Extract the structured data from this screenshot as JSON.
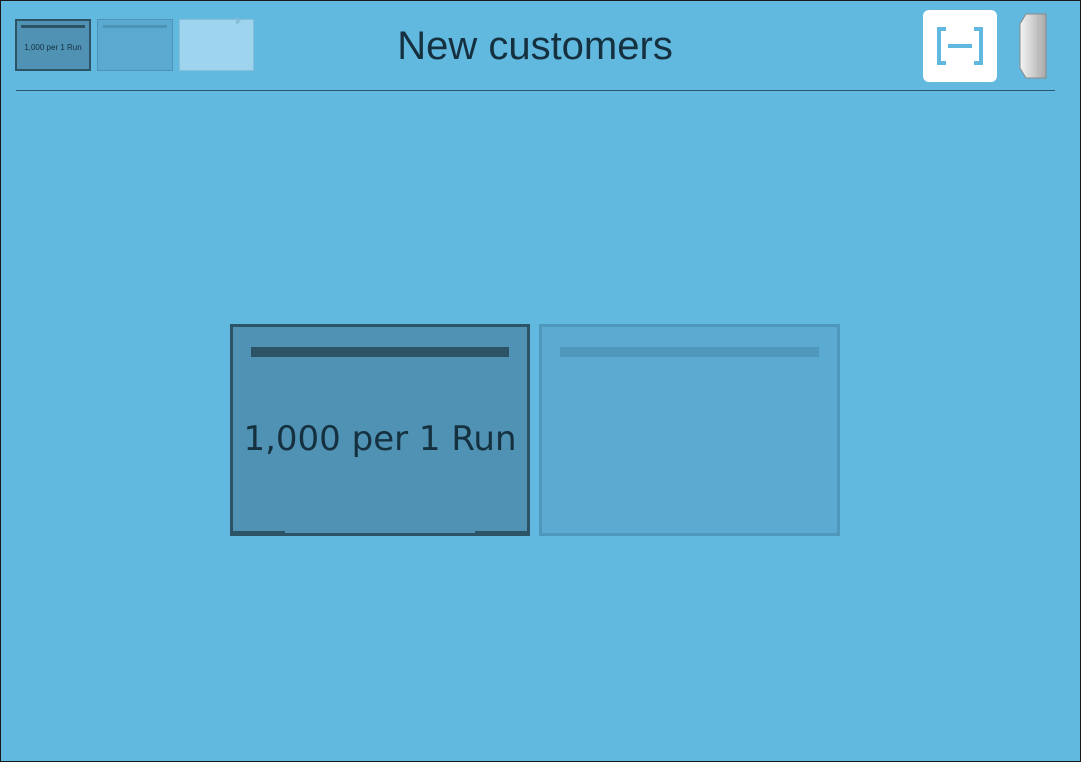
{
  "header": {
    "title": "New customers",
    "fullscreen_icon": "fullscreen-bracket-icon",
    "side_handle_icon": "panel-handle-icon"
  },
  "thumbnails": [
    {
      "label": "1,000 per 1 Run",
      "state": "selected"
    },
    {
      "label": "",
      "state": "normal"
    },
    {
      "label": "",
      "state": "light"
    }
  ],
  "cards": [
    {
      "label": "1,000 per 1 Run",
      "state": "selected"
    },
    {
      "label": "",
      "state": "inactive"
    }
  ],
  "colors": {
    "background": "#62b9e0",
    "selected_fill": "#4f92b3",
    "selected_border": "#2c5366",
    "inactive_fill": "#5aaad1",
    "text": "#15303f"
  }
}
